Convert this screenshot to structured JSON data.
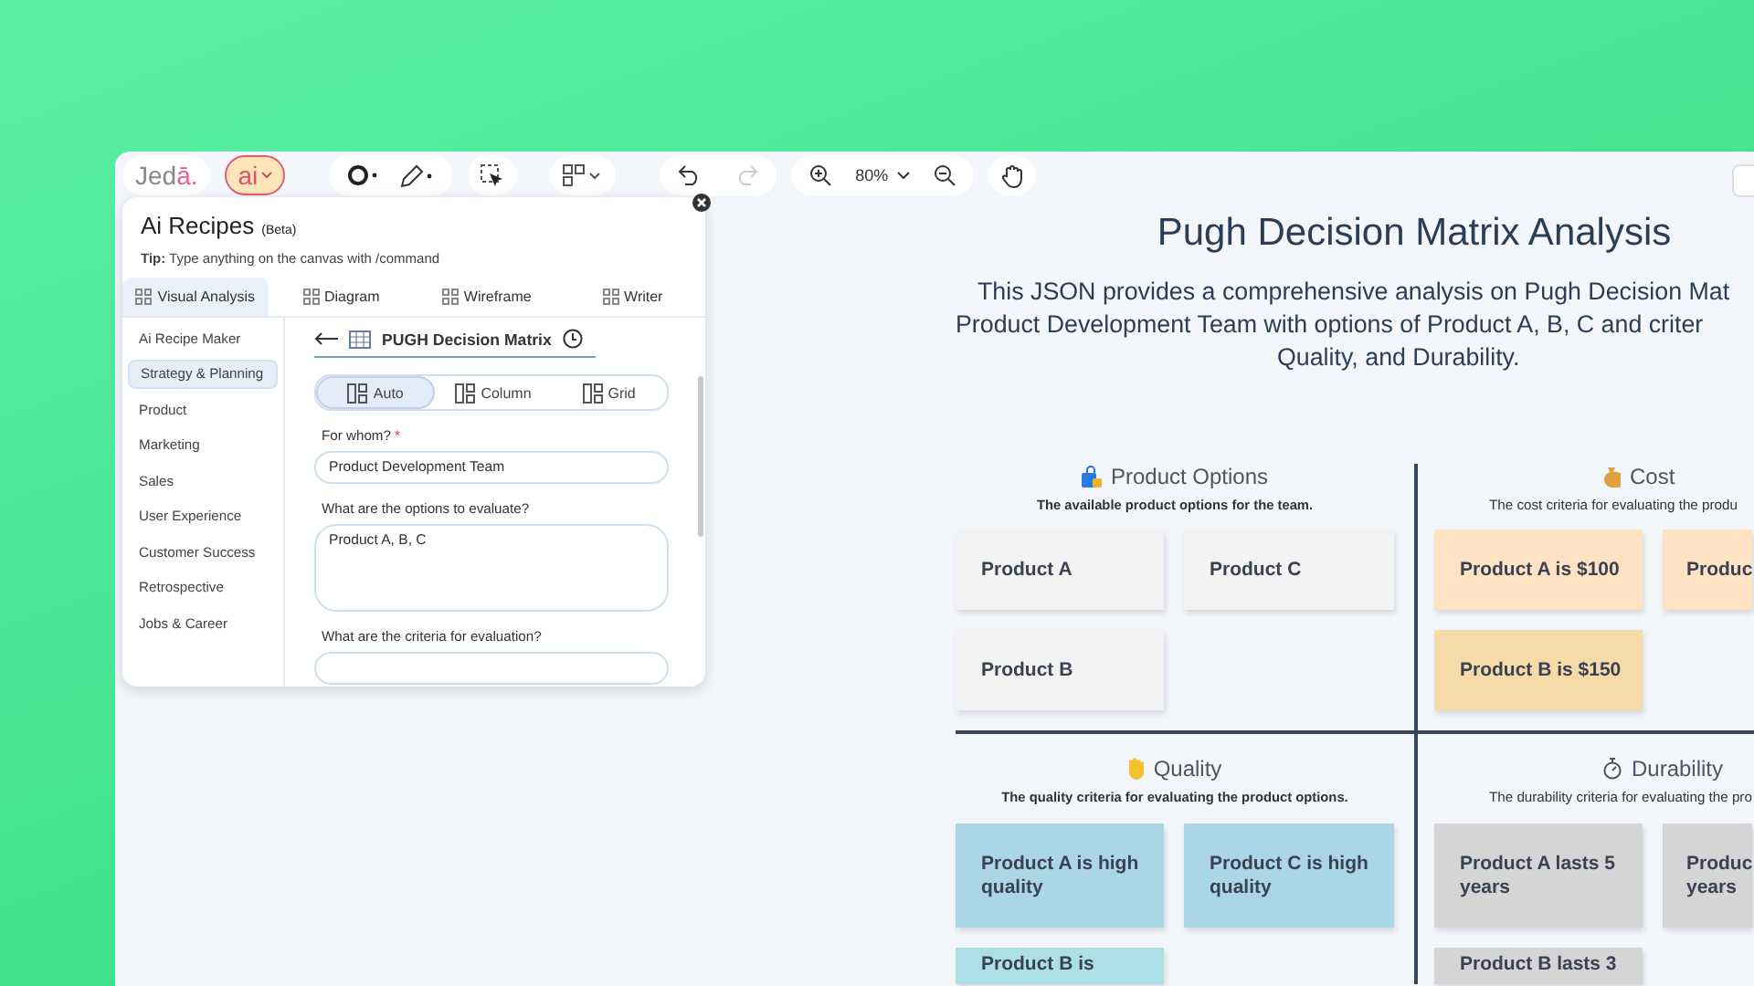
{
  "toolbar": {
    "logo": {
      "text": "Jed",
      "accent": "ā."
    },
    "ai_button": "ai",
    "zoom": "80%"
  },
  "recipes_panel": {
    "title": "Ai Recipes",
    "badge": "(Beta)",
    "tip": "**Tip:** Type anything on the canvas with /command",
    "tabs": [
      {
        "label": "Visual Analysis",
        "selected": true
      },
      {
        "label": "Diagram",
        "selected": false
      },
      {
        "label": "Wireframe",
        "selected": false
      },
      {
        "label": "Writer",
        "selected": false
      }
    ],
    "categories": [
      {
        "label": "Ai Recipe Maker",
        "selected": false
      },
      {
        "label": "Strategy & Planning",
        "selected": true
      },
      {
        "label": "Product",
        "selected": false
      },
      {
        "label": "Marketing",
        "selected": false
      },
      {
        "label": "Sales",
        "selected": false
      },
      {
        "label": "User Experience",
        "selected": false
      },
      {
        "label": "Customer Success",
        "selected": false
      },
      {
        "label": "Retrospective",
        "selected": false
      },
      {
        "label": "Jobs & Career",
        "selected": false
      }
    ],
    "recipe": {
      "title": "PUGH Decision Matrix",
      "layouts": [
        {
          "label": "Auto",
          "selected": true
        },
        {
          "label": "Column",
          "selected": false
        },
        {
          "label": "Grid",
          "selected": false
        }
      ],
      "fields": [
        {
          "kind": "input",
          "label": "For whom?",
          "required_mark": "*",
          "value": "Product Development Team"
        },
        {
          "kind": "textarea",
          "label": "What are the options to evaluate?",
          "value": "Product A, B, C"
        },
        {
          "kind": "input",
          "label": "What are the criteria for evaluation?"
        }
      ]
    }
  },
  "canvas": {
    "title": "Pugh Decision Matrix Analysis",
    "description_lines": [
      "This JSON provides a comprehensive analysis on Pugh Decision Mat",
      "Product Development Team with options of Product A, B, C and criter",
      "Quality, and Durability."
    ],
    "quadrants": [
      {
        "kind": "options",
        "title": "Product Options",
        "subtitle": "The available product options for the team.",
        "cards": [
          {
            "text": "Product A",
            "color": "#f3f3f3"
          },
          {
            "text": "Product C",
            "color": "#f3f3f3"
          },
          {
            "text": "Product B",
            "color": "#f3f3f3"
          }
        ]
      },
      {
        "kind": "cost",
        "title": "Cost",
        "subtitle": "The cost criteria for evaluating the produ",
        "cards": [
          {
            "text": "Product A is $100",
            "color": "#fde3c4"
          },
          {
            "text": "Produc",
            "color": "#fde3c4"
          },
          {
            "text": "Product B is $150",
            "color": "#f6dba9"
          }
        ]
      },
      {
        "kind": "quality",
        "title": "Quality",
        "subtitle": "The quality criteria for evaluating the product options.",
        "cards": [
          {
            "text": "Product A is high quality",
            "color": "#aad6e6"
          },
          {
            "text": "Product C is high quality",
            "color": "#aad6e6"
          },
          {
            "text": "Product B is",
            "color": "#ade0e6"
          }
        ]
      },
      {
        "kind": "durability",
        "title": "Durability",
        "subtitle": "The durability criteria for evaluating the pro",
        "cards": [
          {
            "text": "Product A lasts 5 years",
            "color": "#d5d5d5"
          },
          {
            "text": "Produc years",
            "color": "#d5d5d5"
          },
          {
            "text": "Product B lasts 3",
            "color": "#d5d5d5"
          }
        ]
      }
    ]
  }
}
